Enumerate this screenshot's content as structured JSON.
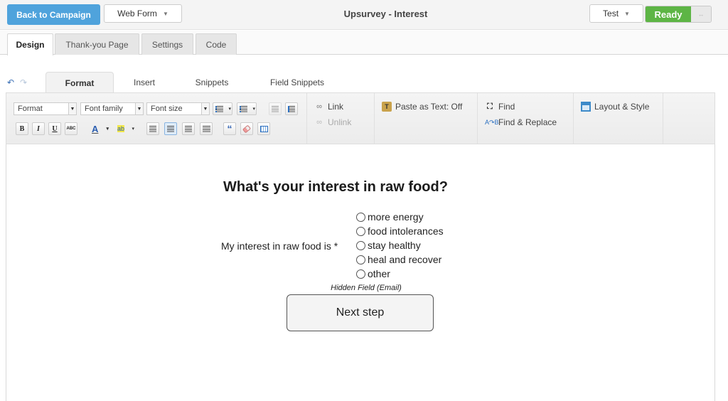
{
  "topbar": {
    "back_label": "Back to Campaign",
    "form_type": "Web Form",
    "title": "Upsurvey - Interest",
    "test_label": "Test",
    "status_label": "Ready",
    "status_toggle_icon": "↔",
    "caret": "▼"
  },
  "main_tabs": [
    {
      "label": "Design",
      "active": true
    },
    {
      "label": "Thank-you Page",
      "active": false
    },
    {
      "label": "Settings",
      "active": false
    },
    {
      "label": "Code",
      "active": false
    }
  ],
  "editor": {
    "undo_icon": "↶",
    "redo_icon": "↷",
    "tabs": [
      {
        "label": "Format",
        "active": true
      },
      {
        "label": "Insert",
        "active": false
      },
      {
        "label": "Snippets",
        "active": false
      },
      {
        "label": "Field Snippets",
        "active": false
      }
    ]
  },
  "toolbar": {
    "format_dd": "Format",
    "font_family_dd": "Font family",
    "font_size_dd": "Font size",
    "bold": "B",
    "italic": "I",
    "underline": "U",
    "strike": "ABC",
    "font_color": "A",
    "highlight": "ab",
    "quote": "“",
    "link_label": "Link",
    "unlink_label": "Unlink",
    "paste_label": "Paste as Text: Off",
    "find_label": "Find",
    "find_replace_label": "Find & Replace",
    "layout_label": "Layout & Style"
  },
  "form": {
    "question": "What's your interest in raw food?",
    "field_label": "My interest in raw food is *",
    "options": [
      "more energy",
      "food intolerances",
      "stay healthy",
      "heal and recover",
      "other"
    ],
    "hidden_field": "Hidden Field (Email)",
    "submit_label": "Next step"
  }
}
